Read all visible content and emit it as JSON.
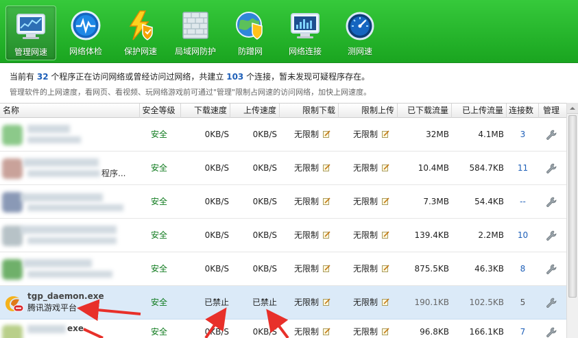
{
  "toolbar": {
    "items": [
      {
        "label": "管理网速",
        "icon": "monitor-chart-icon",
        "active": true
      },
      {
        "label": "网络体检",
        "icon": "heartbeat-icon",
        "active": false
      },
      {
        "label": "保护网速",
        "icon": "lightning-shield-icon",
        "active": false
      },
      {
        "label": "局域网防护",
        "icon": "firewall-icon",
        "active": false
      },
      {
        "label": "防蹭网",
        "icon": "globe-shield-icon",
        "active": false
      },
      {
        "label": "网络连接",
        "icon": "network-monitor-icon",
        "active": false
      },
      {
        "label": "测网速",
        "icon": "speedometer-icon",
        "active": false
      }
    ]
  },
  "info": {
    "line1_prefix": "当前有",
    "program_count": "32",
    "line1_mid": "个程序正在访问网络或曾经访问过网络，共建立",
    "connection_count": "103",
    "line1_suffix": "个连接，暂未发现可疑程序存在。",
    "line2": "管理软件的上网速度，看网页、看视频、玩网络游戏前可通过\"管理\"限制占网速的访问网络，加快上网速度。"
  },
  "table": {
    "headers": {
      "name": "名称",
      "safety": "安全等级",
      "down_speed": "下载速度",
      "up_speed": "上传速度",
      "limit_down": "限制下载",
      "limit_up": "限制上传",
      "downloaded": "已下载流量",
      "uploaded": "已上传流量",
      "connections": "连接数",
      "manage": "管理"
    },
    "rows": [
      {
        "name": "",
        "sub": "",
        "safety": "安全",
        "down": "0KB/S",
        "up": "0KB/S",
        "limit_down": "无限制",
        "limit_up": "无限制",
        "downloaded": "32MB",
        "uploaded": "4.1MB",
        "connections": "3"
      },
      {
        "name": "",
        "sub": "程序...",
        "safety": "安全",
        "down": "0KB/S",
        "up": "0KB/S",
        "limit_down": "无限制",
        "limit_up": "无限制",
        "downloaded": "10.4MB",
        "uploaded": "584.7KB",
        "connections": "11"
      },
      {
        "name": "",
        "sub": "",
        "safety": "安全",
        "down": "0KB/S",
        "up": "0KB/S",
        "limit_down": "无限制",
        "limit_up": "无限制",
        "downloaded": "7.3MB",
        "uploaded": "54.4KB",
        "connections": "--"
      },
      {
        "name": "",
        "sub": "",
        "safety": "安全",
        "down": "0KB/S",
        "up": "0KB/S",
        "limit_down": "无限制",
        "limit_up": "无限制",
        "downloaded": "139.4KB",
        "uploaded": "2.2MB",
        "connections": "10"
      },
      {
        "name": "",
        "sub": "",
        "safety": "安全",
        "down": "0KB/S",
        "up": "0KB/S",
        "limit_down": "无限制",
        "limit_up": "无限制",
        "downloaded": "875.5KB",
        "uploaded": "46.3KB",
        "connections": "8"
      },
      {
        "name": "tgp_daemon.exe",
        "sub": "腾讯游戏平台",
        "safety": "安全",
        "down": "已禁止",
        "up": "已禁止",
        "limit_down": "无限制",
        "limit_up": "无限制",
        "downloaded": "190.1KB",
        "uploaded": "102.5KB",
        "connections": "5"
      },
      {
        "name": "exe",
        "sub": "",
        "safety": "安全",
        "down": "0KB/S",
        "up": "0KB/S",
        "limit_down": "无限制",
        "limit_up": "无限制",
        "downloaded": "96.8KB",
        "uploaded": "166.1KB",
        "connections": "7"
      }
    ]
  },
  "colors": {
    "toolbar_green": "#1aa520",
    "safe_green": "#0e7a1d",
    "link_blue": "#1e5fb8",
    "selected_row": "#dbeaf8",
    "arrow_red": "#e8302a"
  }
}
